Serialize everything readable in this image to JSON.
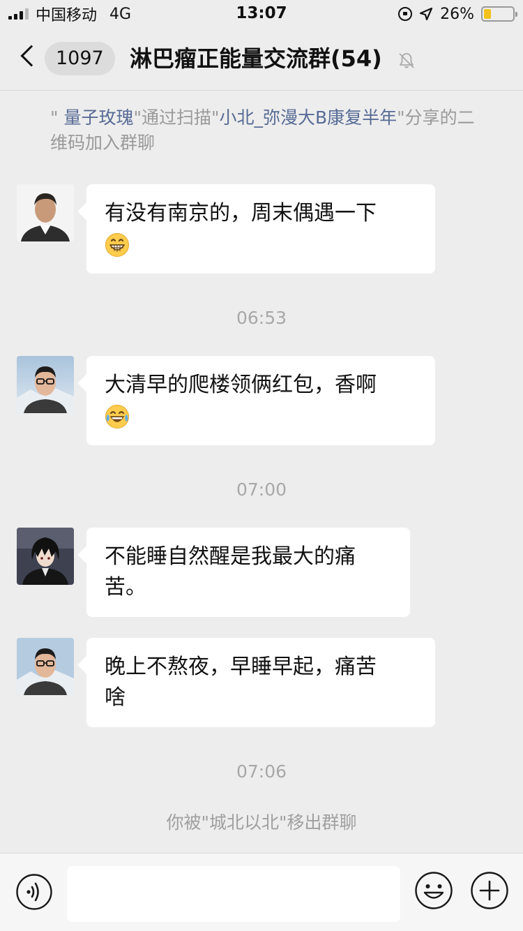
{
  "status_bar": {
    "carrier": "中国移动",
    "network": "4G",
    "time": "13:07",
    "battery_percent": "26%",
    "battery_level": 0.26
  },
  "nav": {
    "back_badge": "1097",
    "title": "淋巴瘤正能量交流群(54)",
    "muted": true
  },
  "system_notice": {
    "open_quote": "\"",
    "name1": "量子玫瑰",
    "text1": "\"通过扫描\"",
    "name2": "小北_弥漫大B康复半年",
    "text2": "\"分享的二维码加入群聊"
  },
  "messages": [
    {
      "line1": "有没有南京的，周末偶遇一下",
      "line2": "",
      "emoji": "grin"
    },
    {
      "line1": "大清早的爬楼领俩红包，香啊",
      "line2": "",
      "emoji": "joy"
    },
    {
      "line1": "不能睡自然醒是我最大的痛",
      "line2": "苦。",
      "emoji": ""
    },
    {
      "line1": "晚上不熬夜，早睡早起，痛苦",
      "line2": "啥",
      "emoji": ""
    }
  ],
  "timestamps": [
    "06:53",
    "07:00",
    "07:06"
  ],
  "removed_notice": "你被\"城北以北\"移出群聊",
  "input": {
    "placeholder": "",
    "value": ""
  },
  "colors": {
    "background": "#ededed",
    "link": "#576b95",
    "bubble": "#ffffff",
    "battery": "#f2c21b"
  }
}
